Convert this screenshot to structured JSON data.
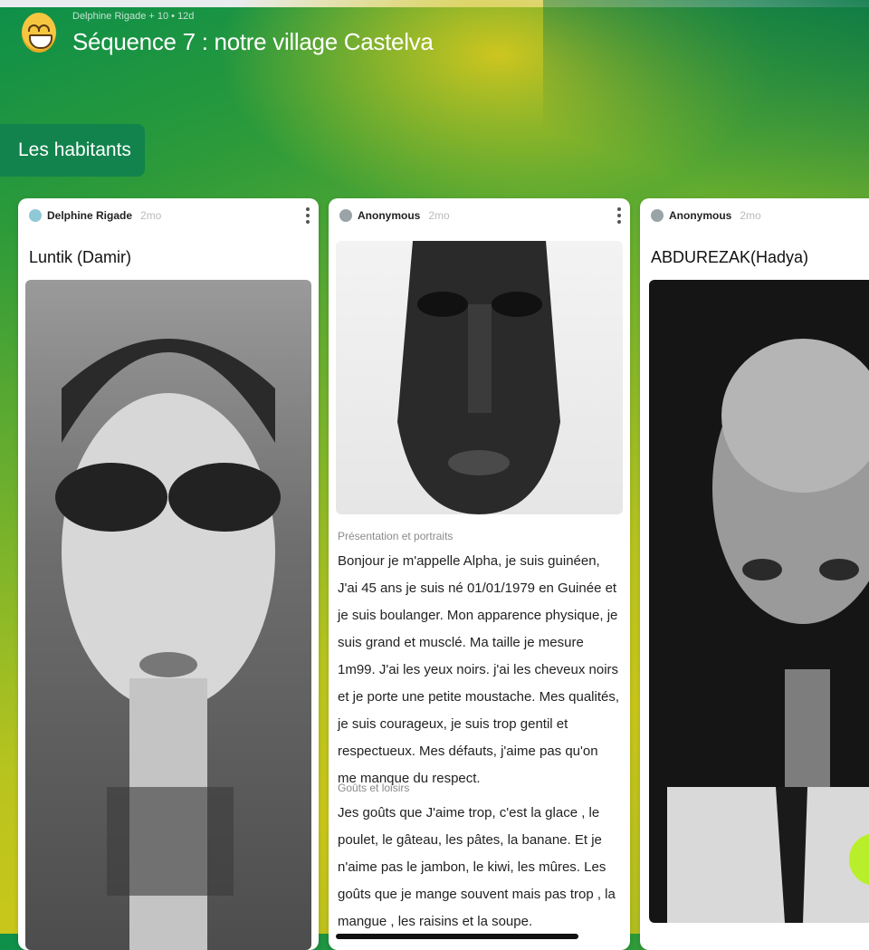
{
  "board": {
    "meta": "Delphine Rigade + 10 • 12d",
    "title": "Séquence 7 : notre village Castelva",
    "section": "Les habitants",
    "icon": "grinning-face-emoji"
  },
  "colors": {
    "section_tab": "#12834d",
    "fab": "#b9ef2a",
    "card_bg": "#ffffff"
  },
  "posts": [
    {
      "author": "Delphine Rigade",
      "age": "2mo",
      "title": "Luntik (Damir)",
      "image": "portrait-woman-black-eye-paint"
    },
    {
      "author": "Anonymous",
      "age": "2mo",
      "image": "portrait-man-closeup",
      "sections": [
        {
          "label": "Présentation et portraits",
          "text": "Bonjour je m'appelle Alpha, je suis guinéen, J'ai 45 ans je suis né 01/01/1979 en Guinée et je suis boulanger. Mon apparence physique, je suis grand et musclé. Ma taille je mesure 1m99. J'ai les yeux noirs. j'ai les cheveux noirs et je porte une petite moustache. Mes qualités, je suis courageux, je suis trop gentil et respectueux. Mes défauts, j'aime pas qu'on me manque du respect."
        },
        {
          "label": "Goûts et loisirs",
          "text": "Jes goûts que J'aime trop, c'est la glace , le poulet, le gâteau, les pâtes, la banane. Et je n'aime pas le jambon, le kiwi, les mûres. Les goûts que  je mange souvent mais pas trop , la mangue , les raisins et la soupe."
        }
      ]
    },
    {
      "author": "Anonymous",
      "age": "2mo",
      "title": "ABDUREZAK(Hadya)",
      "image": "portrait-bald-man"
    }
  ],
  "fab": {
    "label": "+",
    "icon": "plus-icon"
  }
}
